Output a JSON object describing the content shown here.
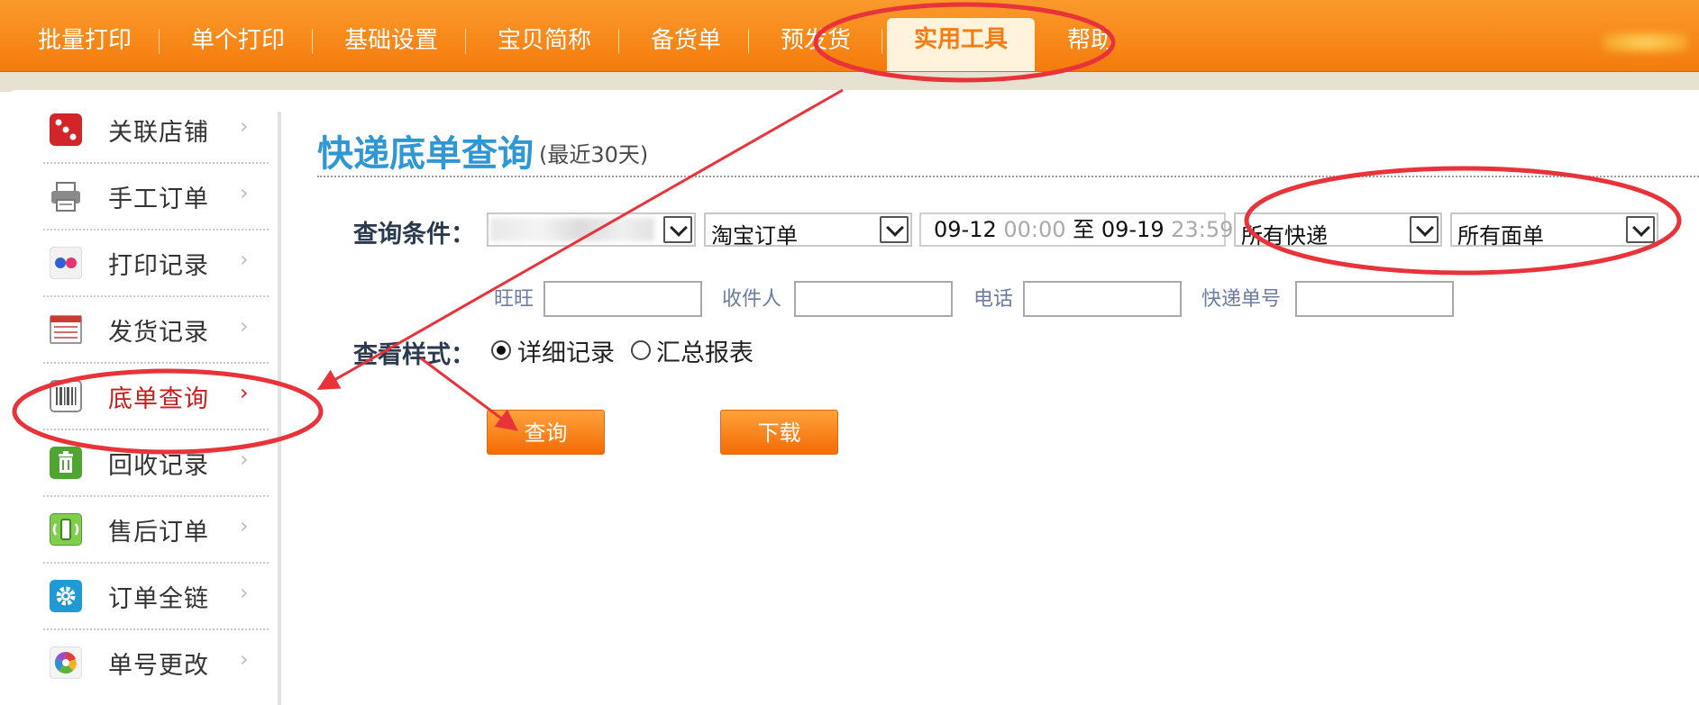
{
  "nav": {
    "items": [
      "批量打印",
      "单个打印",
      "基础设置",
      "宝贝简称",
      "备货单",
      "预发货",
      "实用工具",
      "帮助"
    ],
    "active": "实用工具"
  },
  "sidebar": {
    "items": [
      {
        "label": "关联店铺",
        "icon": "dice-icon",
        "color": "#d2252a"
      },
      {
        "label": "手工订单",
        "icon": "printer-icon",
        "color": "#8a8a8a"
      },
      {
        "label": "打印记录",
        "icon": "dots-icon",
        "color": "#3a63c8"
      },
      {
        "label": "发货记录",
        "icon": "list-sheet-icon",
        "color": "#c93b33"
      },
      {
        "label": "底单查询",
        "icon": "barcode-icon",
        "color": "#666666"
      },
      {
        "label": "回收记录",
        "icon": "recycle-bin-icon",
        "color": "#4ea52f"
      },
      {
        "label": "售后订单",
        "icon": "refresh-phone-icon",
        "color": "#59b23a"
      },
      {
        "label": "订单全链",
        "icon": "gear-icon",
        "color": "#1f9ad6"
      },
      {
        "label": "单号更改",
        "icon": "color-wheel-icon",
        "color": "#e8a020"
      }
    ],
    "active_index": 4,
    "chevron": "›"
  },
  "page": {
    "title": "快递底单查询",
    "subtitle": "(最近30天)"
  },
  "form": {
    "query_label": "查询条件：",
    "order_type": "淘宝订单",
    "date_start": "09-12",
    "time_start": "00:00",
    "date_sep": "至",
    "date_end": "09-19",
    "time_end": "23:59",
    "express": "所有快递",
    "waybill_type": "所有面单",
    "wangwang_label": "旺旺",
    "recipient_label": "收件人",
    "phone_label": "电话",
    "tracking_label": "快递单号",
    "view_label": "查看样式：",
    "view_options": [
      "详细记录",
      "汇总报表"
    ],
    "view_selected": "详细记录",
    "query_button": "查询",
    "download_button": "下载"
  },
  "colors": {
    "nav_bg": "#f7891a",
    "title": "#2f97d4",
    "active_sidebar": "#cc1d1d",
    "annotation": "#e8333a"
  }
}
